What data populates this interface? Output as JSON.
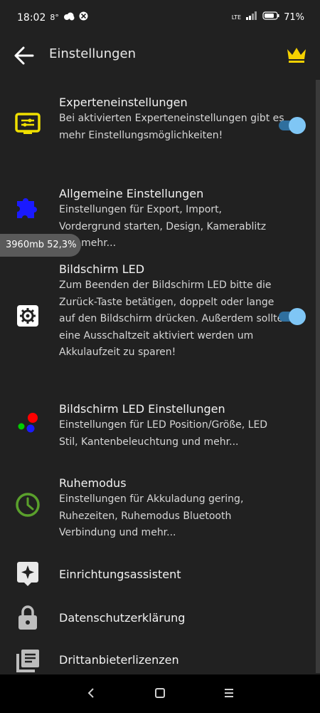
{
  "status": {
    "time": "18:02",
    "temp": "8°",
    "network": "LTE",
    "battery": "71%"
  },
  "appbar": {
    "title": "Einstellungen"
  },
  "overlay": {
    "memory": "3960mb 52,3%"
  },
  "items": [
    {
      "title": "Experteneinstellungen",
      "desc": "Bei aktivierten Experteneinstellungen gibt es mehr Einstellungsmöglichkeiten!",
      "toggle": true
    },
    {
      "title": "Allgemeine Einstellungen",
      "desc": "Einstellungen für Export, Import, Vordergrund starten, Design, Kamerablitz und mehr..."
    },
    {
      "title": "Bildschirm LED",
      "desc": "Zum Beenden der Bildschirm LED bitte die Zurück-Taste betätigen, doppelt oder lange auf den Bildschirm drücken. Außerdem sollte eine Ausschaltzeit aktiviert werden um Akkulaufzeit zu sparen!",
      "toggle": true
    },
    {
      "title": "Bildschirm LED Einstellungen",
      "desc": "Einstellungen für LED Position/Größe, LED Stil, Kantenbeleuchtung und mehr..."
    },
    {
      "title": "Ruhemodus",
      "desc": "Einstellungen für Akkuladung gering, Ruhezeiten, Ruhemodus Bluetooth Verbindung und mehr..."
    },
    {
      "title": "Einrichtungsassistent"
    },
    {
      "title": "Datenschutzerklärung"
    },
    {
      "title": "Drittanbieterlizenzen"
    }
  ],
  "colors": {
    "background": "#212121",
    "accent_toggle": "#7fc6f5",
    "crown": "#f5d100",
    "expert_icon": "#f0e000",
    "general_icon": "#1a1aff",
    "sleep_icon": "#5aa02c"
  },
  "icons": {
    "back": "arrow-back-icon",
    "premium": "crown-icon",
    "expert": "settings-panel-icon",
    "general": "puzzle-icon",
    "led": "gear-icon",
    "led_settings": "color-dots-icon",
    "sleep": "clock-icon",
    "wizard": "sparkle-icon",
    "privacy": "lock-icon",
    "licenses": "library-icon"
  }
}
